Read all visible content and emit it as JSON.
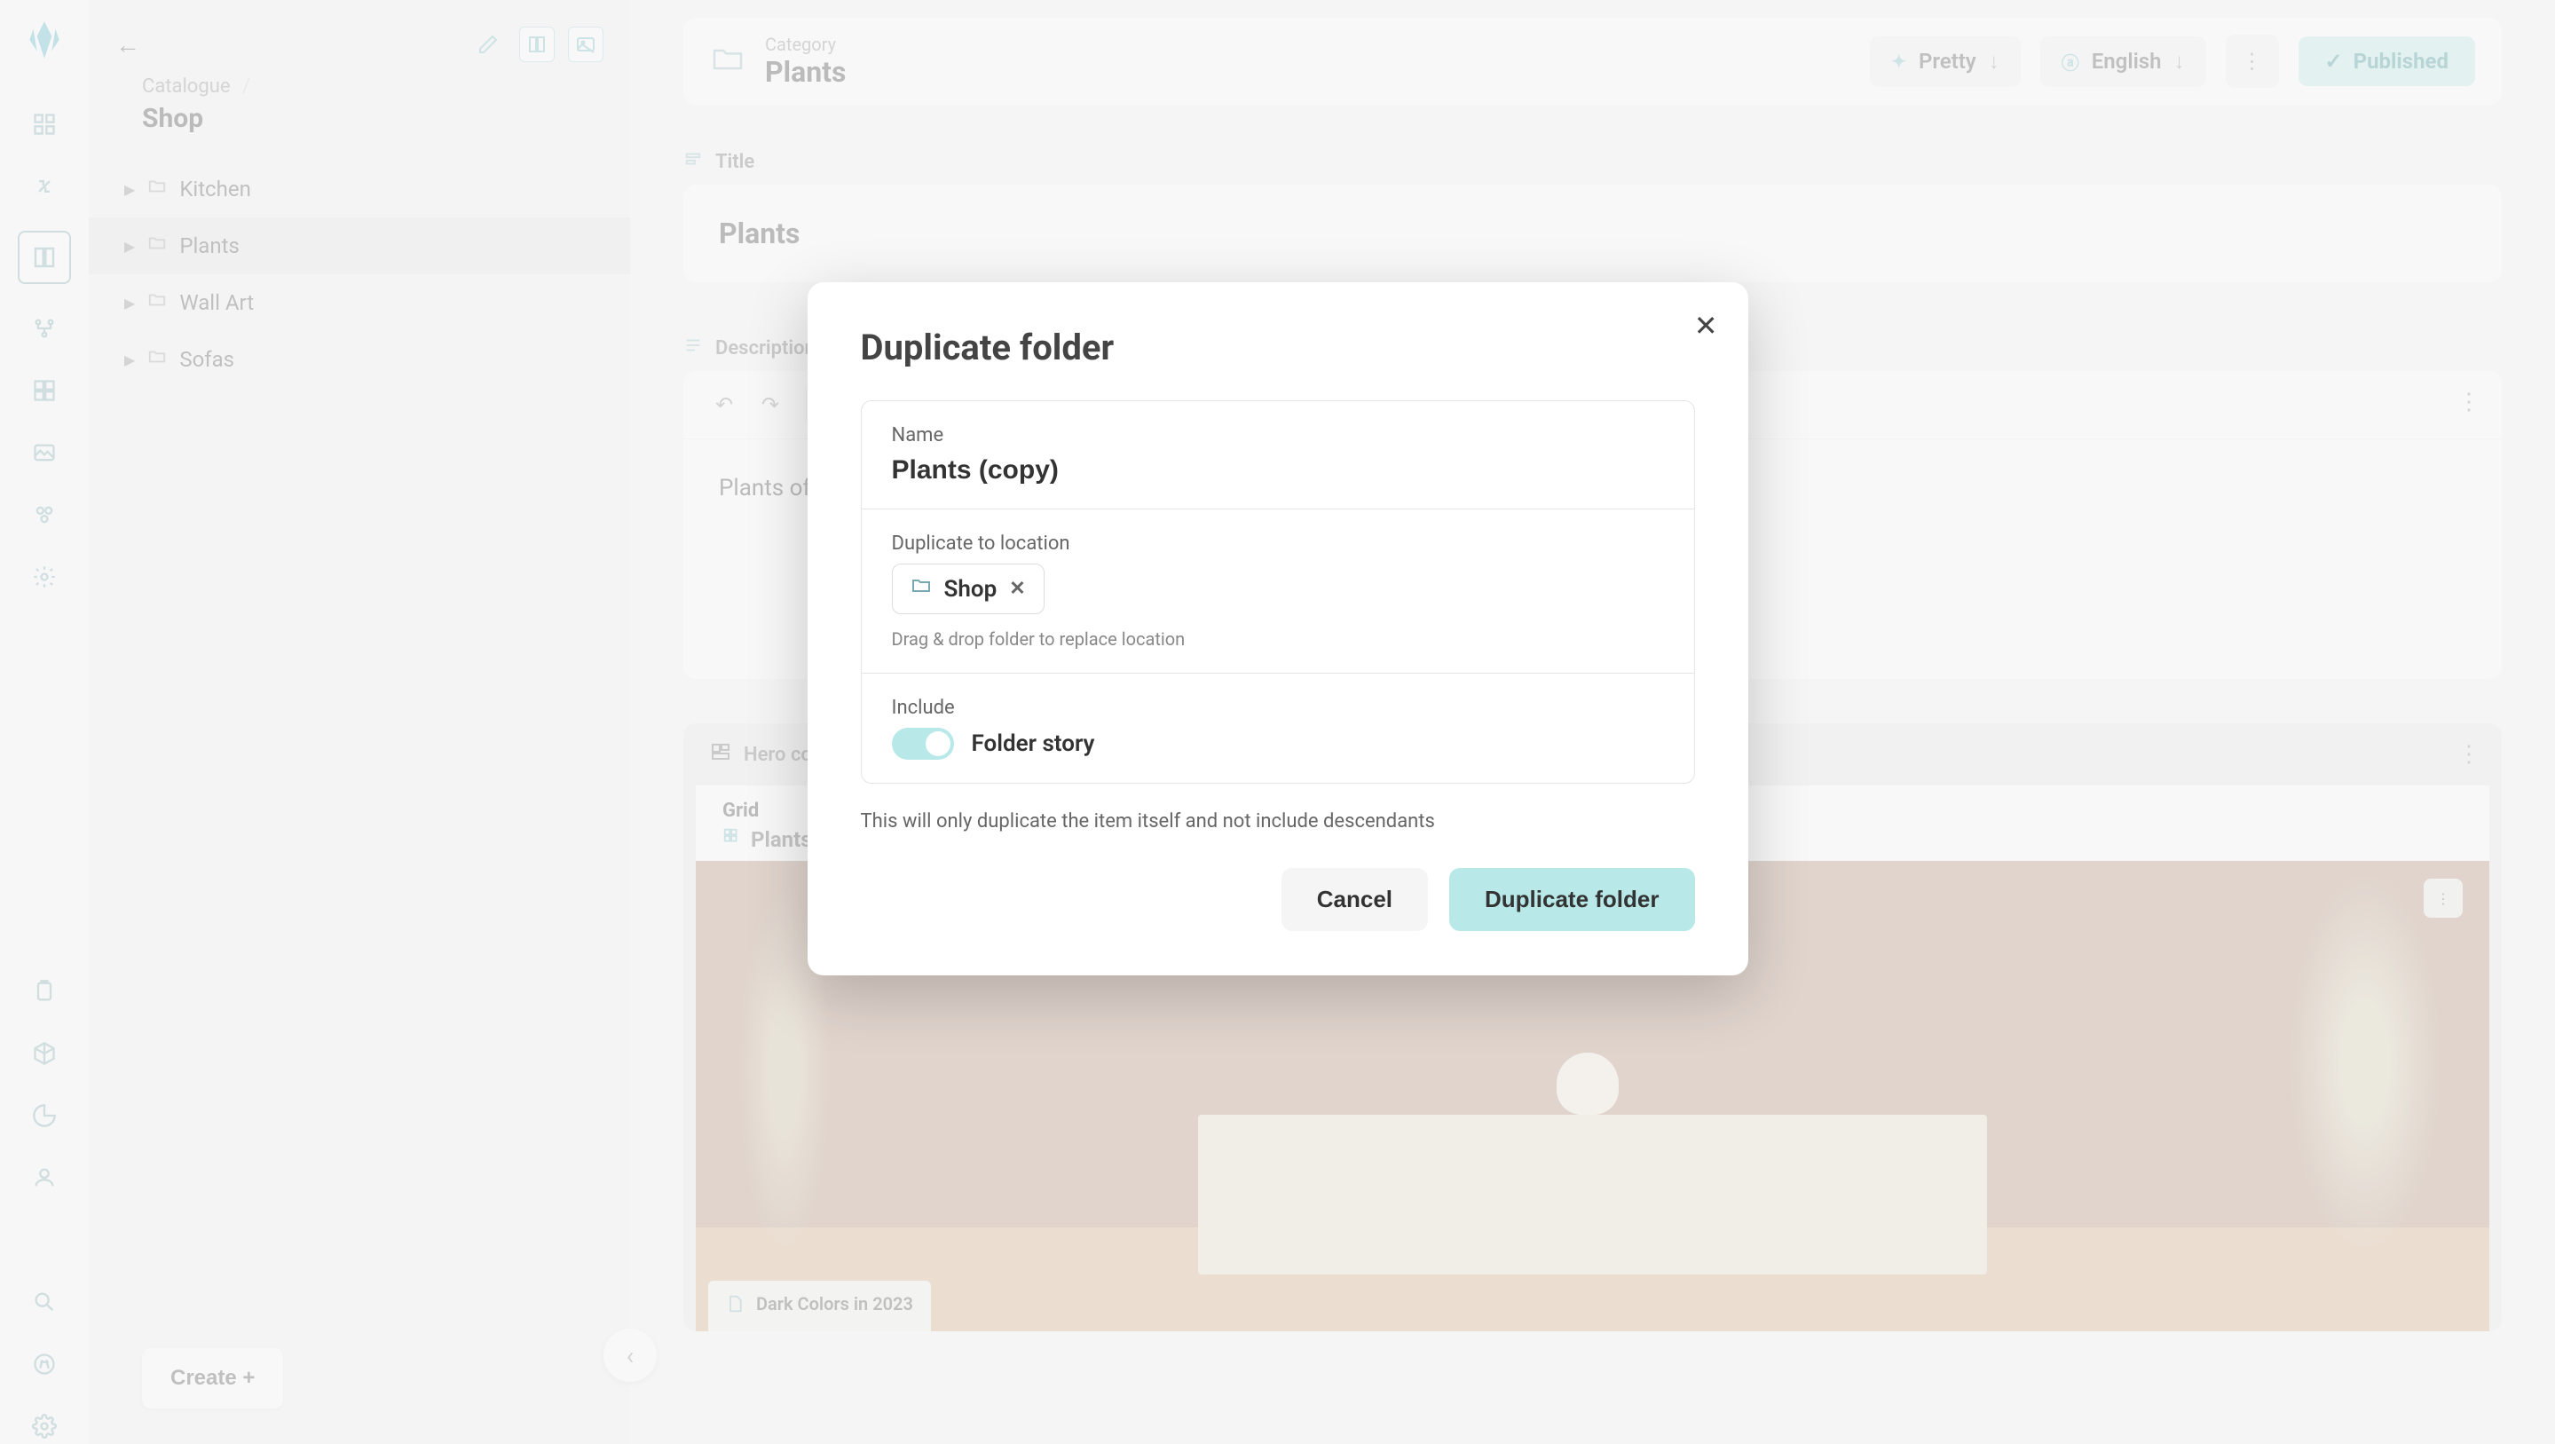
{
  "rail": {
    "icons": [
      "dashboard",
      "connector",
      "catalogue",
      "graph",
      "blocks",
      "image",
      "org",
      "settings-gear",
      "clipboard",
      "cube",
      "pie",
      "user",
      "search",
      "translate",
      "settings"
    ]
  },
  "tree": {
    "breadcrumb_parent": "Catalogue",
    "breadcrumb_sep": "/",
    "breadcrumb_current": "Shop",
    "items": [
      {
        "label": "Kitchen"
      },
      {
        "label": "Plants"
      },
      {
        "label": "Wall Art"
      },
      {
        "label": "Sofas"
      }
    ],
    "create_label": "Create +"
  },
  "header": {
    "category_label": "Category",
    "category_value": "Plants",
    "pretty_label": "Pretty",
    "language_label": "English",
    "published_label": "Published"
  },
  "sections": {
    "title_label": "Title",
    "title_value": "Plants",
    "description_label": "Description",
    "description_body": "Plants of all shapes and sizes for your home.",
    "hero_label": "Hero content",
    "grid_label": "Grid",
    "grid_ref": "Plants",
    "doc_chip": "Dark Colors in 2023"
  },
  "modal": {
    "title": "Duplicate folder",
    "name_label": "Name",
    "name_value": "Plants (copy)",
    "location_label": "Duplicate to location",
    "location_chip": "Shop",
    "location_hint": "Drag & drop folder to replace location",
    "include_label": "Include",
    "toggle_label": "Folder story",
    "note": "This will only duplicate the item itself and not include descendants",
    "cancel_label": "Cancel",
    "confirm_label": "Duplicate folder"
  }
}
